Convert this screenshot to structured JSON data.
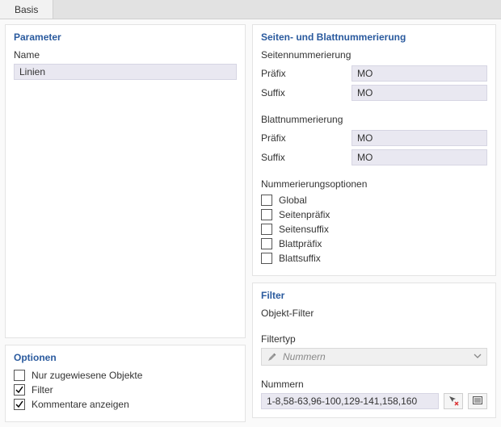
{
  "tab": {
    "label": "Basis"
  },
  "parameter": {
    "title": "Parameter",
    "name_label": "Name",
    "name_value": "Linien"
  },
  "optionen": {
    "title": "Optionen",
    "items": [
      {
        "label": "Nur zugewiesene Objekte",
        "checked": false
      },
      {
        "label": "Filter",
        "checked": true
      },
      {
        "label": "Kommentare anzeigen",
        "checked": true
      }
    ]
  },
  "numbering": {
    "title": "Seiten- und Blattnummerierung",
    "page": {
      "heading": "Seitennummerierung",
      "prefix_label": "Präfix",
      "prefix_value": "MO",
      "suffix_label": "Suffix",
      "suffix_value": "MO"
    },
    "sheet": {
      "heading": "Blattnummerierung",
      "prefix_label": "Präfix",
      "prefix_value": "MO",
      "suffix_label": "Suffix",
      "suffix_value": "MO"
    },
    "options": {
      "heading": "Nummerierungsoptionen",
      "items": [
        {
          "label": "Global",
          "checked": false
        },
        {
          "label": "Seitenpräfix",
          "checked": false
        },
        {
          "label": "Seitensuffix",
          "checked": false
        },
        {
          "label": "Blattpräfix",
          "checked": false
        },
        {
          "label": "Blattsuffix",
          "checked": false
        }
      ]
    }
  },
  "filter": {
    "title": "Filter",
    "object_filter_label": "Objekt-Filter",
    "type_label": "Filtertyp",
    "type_value": "Nummern",
    "numbers_label": "Nummern",
    "numbers_value": "1-8,58-63,96-100,129-141,158,160"
  }
}
